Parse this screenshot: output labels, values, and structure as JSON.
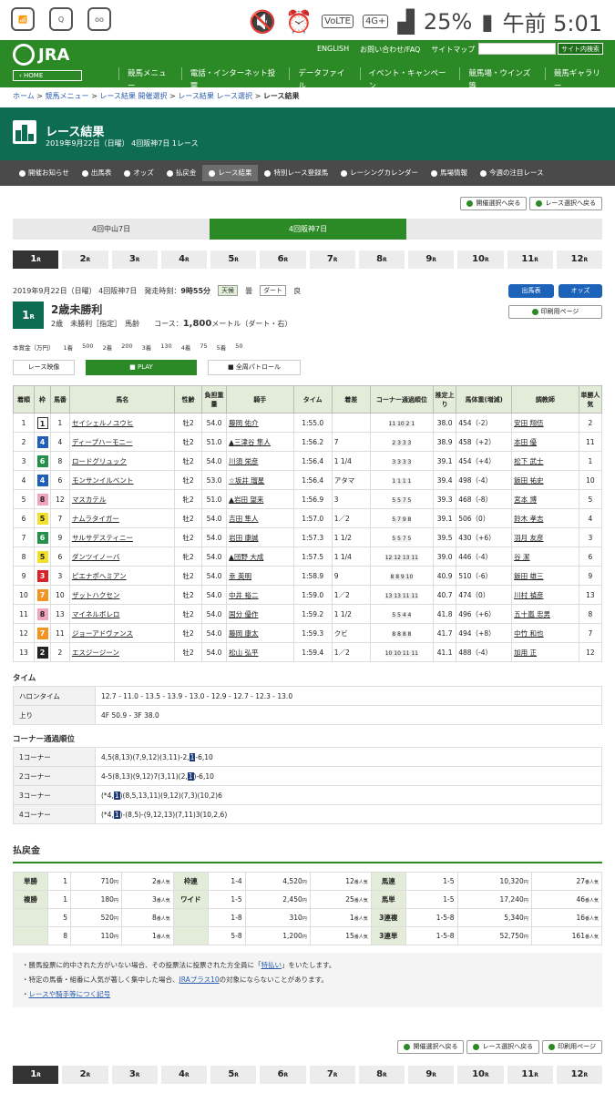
{
  "status": {
    "battery": "25%",
    "time": "午前 5:01",
    "net": "4G+",
    "volte": "VoLTE"
  },
  "header": {
    "logo": "JRA",
    "home": "‹ HOME",
    "toplinks": [
      "ENGLISH",
      "お問い合わせ/FAQ",
      "サイトマップ"
    ],
    "search_btn": "サイト内検索",
    "gnav": [
      "競馬メニュー",
      "電話・インターネット投票",
      "データファイル",
      "イベント・キャンペーン",
      "競馬場・ウインズ等",
      "競馬ギャラリー"
    ]
  },
  "breadcrumb": [
    "ホーム",
    "競馬メニュー",
    "レース結果 開催選択",
    "レース結果 レース選択",
    "レース結果"
  ],
  "title": {
    "main": "レース結果",
    "sub": "2019年9月22日（日曜） 4回阪神7日 1レース"
  },
  "subnav": [
    "開催お知らせ",
    "出馬表",
    "オッズ",
    "払戻金",
    "レース結果",
    "特別レース登録馬",
    "レーシングカレンダー",
    "馬場情報",
    "今週の注目レース"
  ],
  "topbtns": [
    "開催選択へ戻る",
    "レース選択へ戻る"
  ],
  "meet_tabs": [
    "4回中山7日",
    "4回阪神7日",
    ""
  ],
  "races": [
    "1",
    "2",
    "3",
    "4",
    "5",
    "6",
    "7",
    "8",
    "9",
    "10",
    "11",
    "12"
  ],
  "race_suffix": "R",
  "info": {
    "date": "2019年9月22日（日曜） 4回阪神7日",
    "start": "発走時刻：",
    "start_time": "9時55分",
    "tenki": "天候",
    "tenki_v": "曇",
    "dirt": "ダート",
    "dirt_v": "良",
    "race_no": "1",
    "race_no_r": "R",
    "name": "2歳未勝利",
    "cond": "2歳　未勝利［指定］　馬齢　　コース：",
    "dist": "1,800",
    "dist_unit": "メートル（ダート・右）",
    "btn_shutuba": "出馬表",
    "btn_odds": "オッズ",
    "btn_print": "印刷用ページ"
  },
  "prize": [
    "本賞金（万円）",
    "1着",
    "500",
    "2着",
    "200",
    "3着",
    "130",
    "4着",
    "75",
    "5着",
    "50"
  ],
  "video": {
    "a": "レース映像",
    "b": "PLAY",
    "c": "全周パトロール"
  },
  "table_head": [
    "着順",
    "枠",
    "馬番",
    "馬名",
    "性齢",
    "負担重量",
    "騎手",
    "タイム",
    "着差",
    "コーナー通過順位",
    "推定上り",
    "馬体重(増減)",
    "調教師",
    "単勝人気"
  ],
  "rows": [
    [
      "1",
      "1",
      "1",
      "セイシェルノユウヒ",
      "牡2",
      "54.0",
      "藤岡 佑介",
      "1:55.0",
      "",
      "11 10 2 1",
      "38.0",
      "454（-2）",
      "安田 翔伍",
      "2"
    ],
    [
      "2",
      "4",
      "4",
      "ディープハーモニー",
      "牡2",
      "51.0",
      "▲三津谷 隼人",
      "1:56.2",
      "7",
      "2 3 3 3",
      "38.9",
      "458（+2）",
      "本田 優",
      "11"
    ],
    [
      "3",
      "6",
      "8",
      "ロードグリュック",
      "牡2",
      "54.0",
      "川須 栄彦",
      "1:56.4",
      "1 1/4",
      "3 3 3 3",
      "39.1",
      "454（+4）",
      "松下 武士",
      "1"
    ],
    [
      "4",
      "4",
      "6",
      "モンサンイルベント",
      "牡2",
      "53.0",
      "☆坂井 瑠星",
      "1:56.4",
      "アタマ",
      "1 1 1 1",
      "39.4",
      "498（-4）",
      "飯田 祐史",
      "10"
    ],
    [
      "5",
      "8",
      "12",
      "マスカテル",
      "牝2",
      "51.0",
      "▲岩田 望来",
      "1:56.9",
      "3",
      "5 5 7 5",
      "39.3",
      "468（-8）",
      "宮本 博",
      "5"
    ],
    [
      "6",
      "5",
      "7",
      "ナムラタイガー",
      "牡2",
      "54.0",
      "吉田 隼人",
      "1:57.0",
      "1／2",
      "5 7 9 8",
      "39.1",
      "506（0）",
      "鈴木 孝志",
      "4"
    ],
    [
      "7",
      "6",
      "9",
      "サルサデスティニー",
      "牡2",
      "54.0",
      "岩田 康誠",
      "1:57.3",
      "1 1/2",
      "5 5 7 5",
      "39.5",
      "430（+6）",
      "羽月 友彦",
      "3"
    ],
    [
      "8",
      "5",
      "6",
      "ダンツイノーバ",
      "牝2",
      "54.0",
      "▲団野 大成",
      "1:57.5",
      "1 1/4",
      "12 12 13 11",
      "39.0",
      "446（-4）",
      "谷 潔",
      "6"
    ],
    [
      "9",
      "3",
      "3",
      "ピエナポヘミアン",
      "牡2",
      "54.0",
      "幸 英明",
      "1:58.9",
      "9",
      "8 8 9 10",
      "40.9",
      "510（-6）",
      "飯田 雄三",
      "9"
    ],
    [
      "10",
      "7",
      "10",
      "ザットハクセン",
      "牡2",
      "54.0",
      "中井 裕二",
      "1:59.0",
      "1／2",
      "13 13 11 11",
      "40.7",
      "474（0）",
      "川村 禎彦",
      "13"
    ],
    [
      "11",
      "8",
      "13",
      "マイネルボレロ",
      "牡2",
      "54.0",
      "国分 優作",
      "1:59.2",
      "1 1/2",
      "5 5 4 4",
      "41.8",
      "496（+6）",
      "五十嵐 忠男",
      "8"
    ],
    [
      "12",
      "7",
      "11",
      "ジョーアドヴァンス",
      "牡2",
      "54.0",
      "藤岡 康太",
      "1:59.3",
      "クビ",
      "8 8 8 8",
      "41.7",
      "494（+8）",
      "中竹 和也",
      "7"
    ],
    [
      "13",
      "2",
      "2",
      "エスジージーン",
      "牡2",
      "54.0",
      "松山 弘平",
      "1:59.4",
      "1／2",
      "10 10 11 11",
      "41.1",
      "488（-4）",
      "加用 正",
      "12"
    ]
  ],
  "time_sec": {
    "title": "タイム",
    "rows": [
      [
        "ハロンタイム",
        "12.7 - 11.0 - 13.5 - 13.9 - 13.0 - 12.9 - 12.7 - 12.3 - 13.0"
      ],
      [
        "上り",
        "4F 50.9 - 3F 38.0"
      ]
    ]
  },
  "corner_sec": {
    "title": "コーナー通過順位",
    "rows": [
      [
        "1コーナー",
        "4,5(8,13)(7,9,12)(3,11)-2,",
        "1",
        "-6,10"
      ],
      [
        "2コーナー",
        "4-5(8,13)(9,12)7(3,11)(2,",
        "1",
        ")-6,10"
      ],
      [
        "3コーナー",
        "(*4,",
        "1",
        ")(8,5,13,11)(9,12)(7,3)(10,2)6"
      ],
      [
        "4コーナー",
        "(*4,",
        "1",
        ")-(8,5)-(9,12,13)(7,11)3(10,2,6)"
      ]
    ]
  },
  "pay": {
    "title": "払戻金",
    "rows": [
      [
        "単勝",
        "1",
        "710",
        "2",
        "枠連",
        "1-4",
        "4,520",
        "12",
        "馬連",
        "1-5",
        "10,320",
        "27"
      ],
      [
        "複勝",
        "1",
        "180",
        "3",
        "ワイド",
        "1-5",
        "2,450",
        "25",
        "馬単",
        "1-5",
        "17,240",
        "46"
      ],
      [
        "",
        "5",
        "520",
        "8",
        "",
        "1-8",
        "310",
        "1",
        "3連複",
        "1-5-8",
        "5,340",
        "16"
      ],
      [
        "",
        "8",
        "110",
        "1",
        "",
        "5-8",
        "1,200",
        "15",
        "3連単",
        "1-5-8",
        "52,750",
        "161"
      ]
    ],
    "yen": "円",
    "ninki": "番人気"
  },
  "notes": [
    "勝馬投票に的中された方がいない場合、その投票法に投票された方全員に「",
    "特払い",
    "」をいたします。",
    "特定の馬番・組番に人気が著しく集中した場合、",
    "JRAプラス10",
    "の対象にならないことがあります。",
    "レースや騎手等につく記号"
  ],
  "bottombtns": [
    "開催選択へ戻る",
    "レース選択へ戻る",
    "印刷用ページ"
  ],
  "colors": {
    "green": "#2c8a26",
    "teal": "#0e6c52"
  }
}
